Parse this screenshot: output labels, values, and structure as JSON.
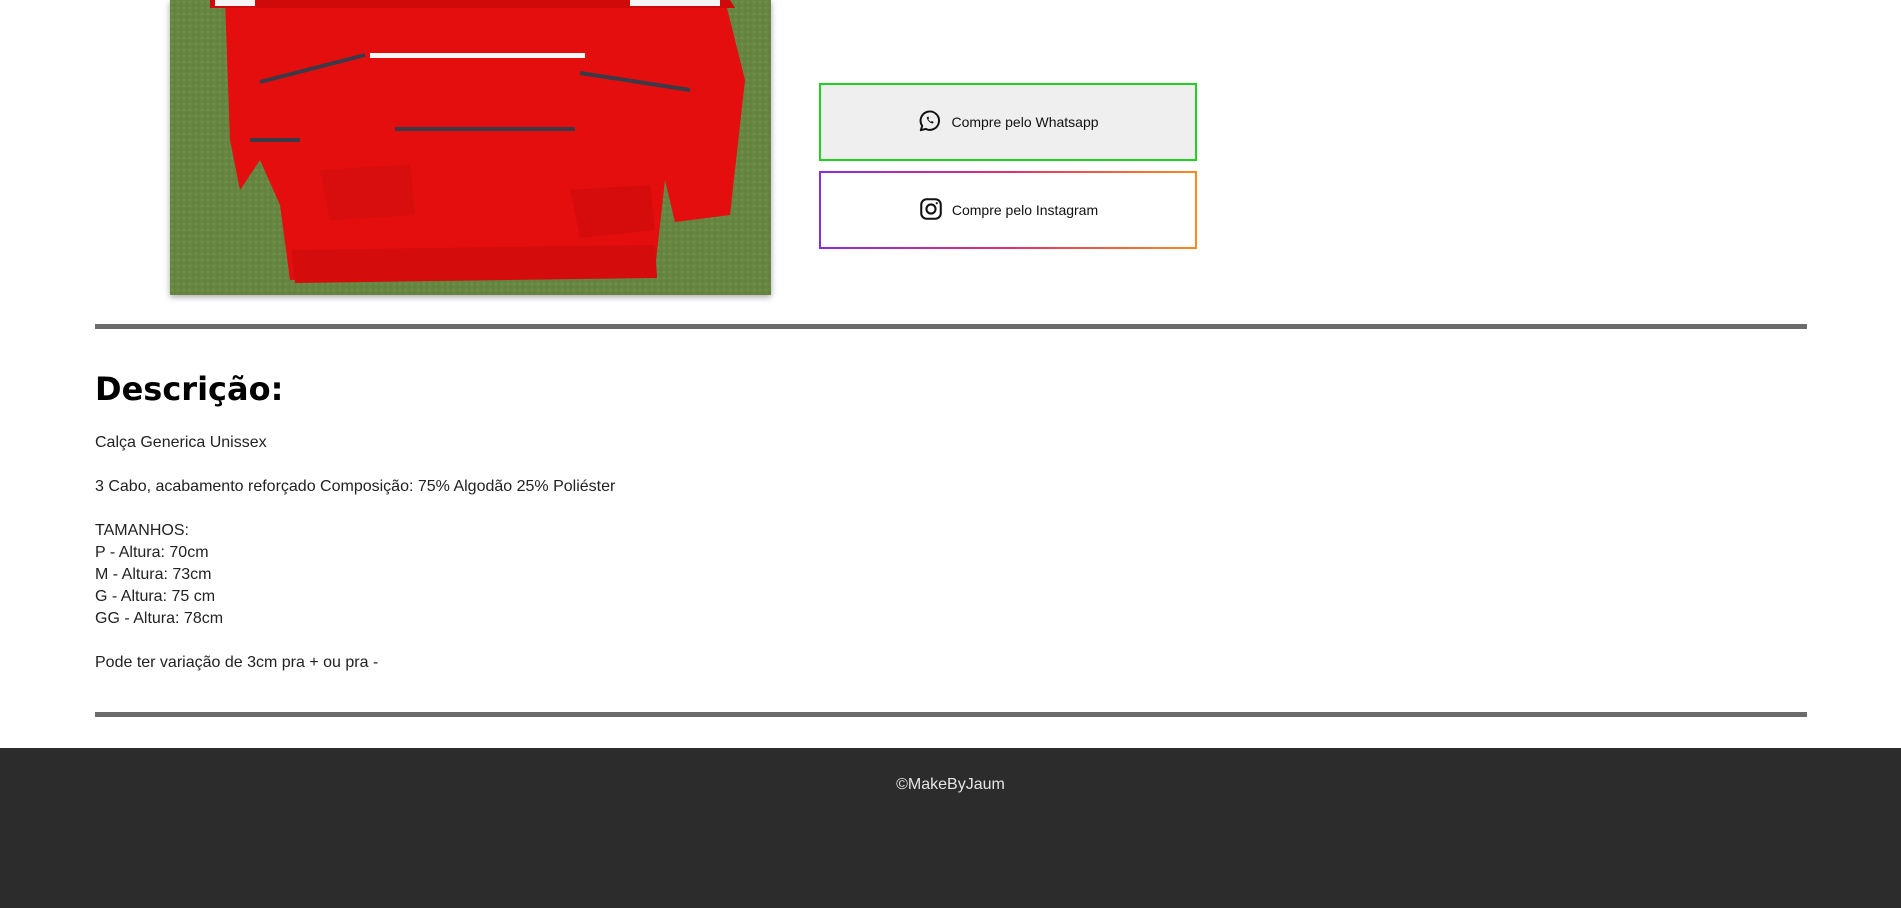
{
  "product": {
    "image_alt": "Red sweater with white and dark stripes on grass"
  },
  "buy_buttons": {
    "whatsapp_label": "Compre pelo Whatsapp",
    "whatsapp_icon": "whatsapp-icon",
    "instagram_label": "Compre pelo Instagram",
    "instagram_icon": "instagram-icon"
  },
  "description": {
    "title": "Descrição:",
    "name": "Calça Generica Unissex",
    "composition": "3 Cabo, acabamento reforçado Composição: 75% Algodão 25% Poliéster",
    "sizes_title": "TAMANHOS:",
    "sizes": [
      "P - Altura: 70cm",
      "M - Altura: 73cm",
      "G - Altura: 75 cm",
      "GG - Altura: 78cm"
    ],
    "variation_note": "Pode ter variação de 3cm pra + ou pra -"
  },
  "footer": {
    "copyright": "©MakeByJaum"
  },
  "colors": {
    "whatsapp_border": "#22d11f",
    "divider": "#6b6b6b",
    "footer_bg": "#2c2c2c"
  }
}
